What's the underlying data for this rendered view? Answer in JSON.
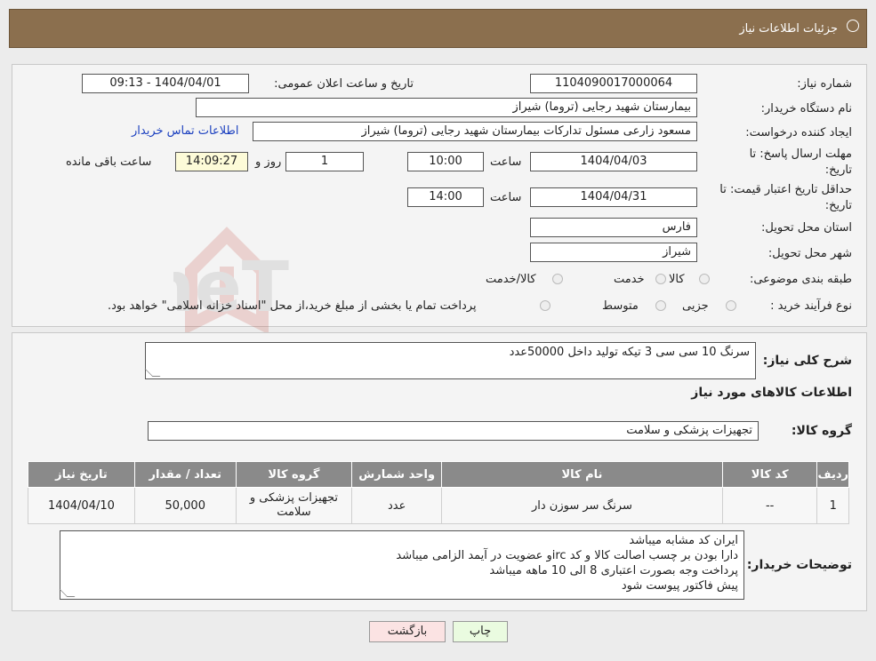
{
  "header": {
    "title": "جزئیات اطلاعات نیاز"
  },
  "form": {
    "need_number_label": "شماره نیاز:",
    "need_number": "1104090017000064",
    "announce_label": "تاریخ و ساعت اعلان عمومی:",
    "announce_value": "1404/04/01 - 09:13",
    "buyer_org_label": "نام دستگاه خریدار:",
    "buyer_org": "بیمارستان شهید رجایی (تروما) شیراز",
    "requester_label": "ایجاد کننده درخواست:",
    "requester": "مسعود زارعی مسئول تدارکات بیمارستان شهید رجایی (تروما) شیراز",
    "contact_link": "اطلاعات تماس خریدار",
    "reply_deadline_label": "مهلت ارسال پاسخ: تا تاریخ:",
    "reply_date": "1404/04/03",
    "time_label": "ساعت",
    "reply_time": "10:00",
    "days_value": "1",
    "days_label": "روز و",
    "remaining_time": "14:09:27",
    "remaining_label": "ساعت باقی مانده",
    "validity_label": "حداقل تاریخ اعتبار قیمت: تا تاریخ:",
    "validity_date": "1404/04/31",
    "validity_time": "14:00",
    "province_label": "استان محل تحویل:",
    "province": "فارس",
    "city_label": "شهر محل تحویل:",
    "city": "شیراز",
    "category_label": "طبقه بندی موضوعی:",
    "category_options": [
      "کالا",
      "خدمت",
      "کالا/خدمت"
    ],
    "process_label": "نوع فرآیند خرید :",
    "process_options": [
      "جزیی",
      "متوسط"
    ],
    "process_note": "پرداخت تمام یا بخشی از مبلغ خرید،از محل \"اسناد خزانه اسلامی\" خواهد بود."
  },
  "details": {
    "summary_label": "شرح کلی نیاز:",
    "summary": "سرنگ 10 سی سی 3 تیکه تولید داخل 50000عدد",
    "goods_info_title": "اطلاعات کالاهای مورد نیاز",
    "group_label": "گروه کالا:",
    "group_value": "تجهیزات پزشکی و سلامت",
    "table": {
      "headers": [
        "ردیف",
        "کد کالا",
        "نام کالا",
        "واحد شمارش",
        "گروه کالا",
        "تعداد / مقدار",
        "تاریخ نیاز"
      ],
      "rows": [
        [
          "1",
          "--",
          "سرنگ سر سوزن دار",
          "عدد",
          "تجهیزات پزشکی و سلامت",
          "50,000",
          "1404/04/10"
        ]
      ]
    },
    "buyer_notes_label": "توضیحات خریدار:",
    "buyer_notes": [
      "ایران کد مشابه میباشد",
      "دارا بودن بر چسب اصالت کالا و کد ircو عضویت در آیمد الزامی میباشد",
      "پرداخت وجه بصورت اعتباری 8 الی 10 ماهه میباشد",
      "پیش فاکتور پیوست شود"
    ]
  },
  "buttons": {
    "print": "چاپ",
    "back": "بازگشت"
  },
  "watermark_text": "AriaTender.neT"
}
